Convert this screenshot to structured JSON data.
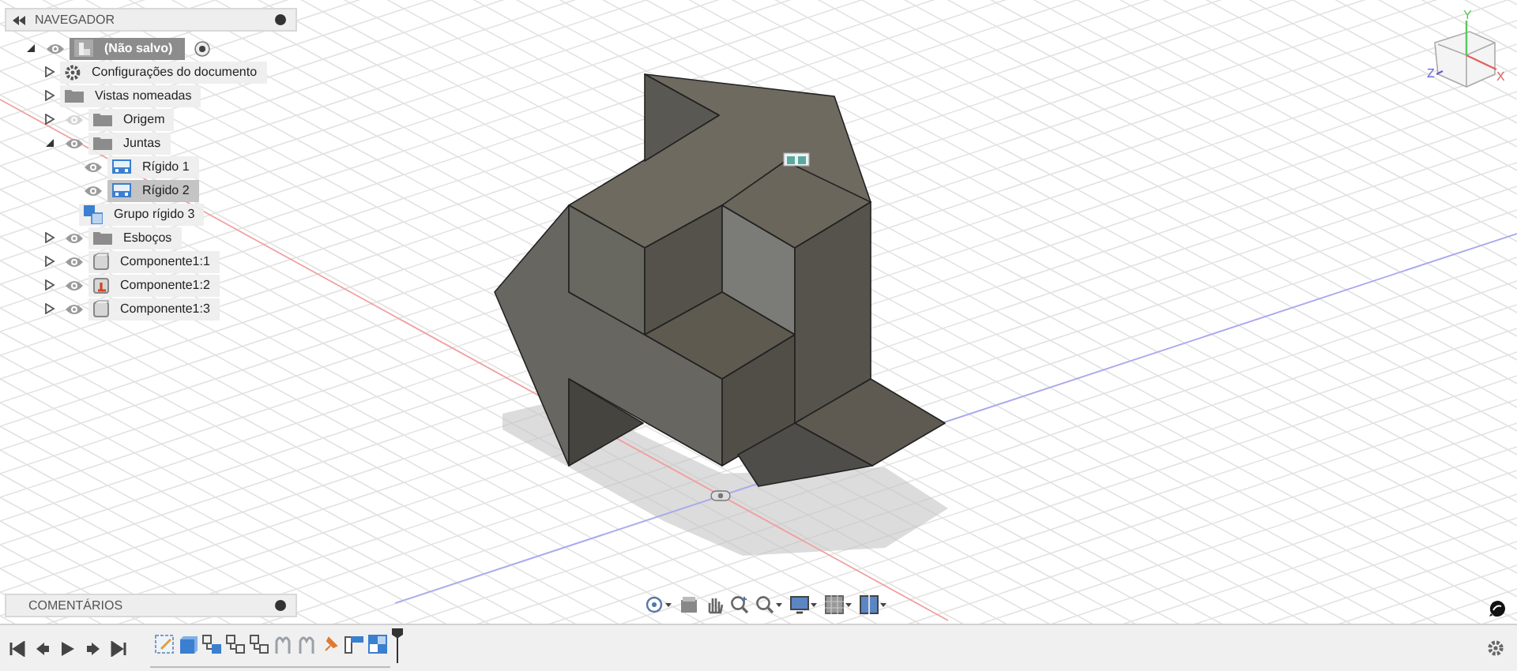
{
  "navigator": {
    "title": "NAVEGADOR",
    "tree": [
      {
        "label": "(Não salvo)",
        "kind": "document",
        "visible": true,
        "expanded": true,
        "selected": false,
        "children": [
          {
            "label": "Configurações do documento",
            "kind": "settings",
            "expanded": false,
            "selected": false
          },
          {
            "label": "Vistas nomeadas",
            "kind": "folder",
            "expanded": false,
            "selected": false
          },
          {
            "label": "Origem",
            "kind": "folder",
            "visible": false,
            "expanded": false,
            "selected": false
          },
          {
            "label": "Juntas",
            "kind": "folder",
            "visible": true,
            "expanded": true,
            "selected": false,
            "children": [
              {
                "label": "Rígido 1",
                "kind": "joint",
                "visible": true,
                "selected": false
              },
              {
                "label": "Rígido 2",
                "kind": "joint",
                "visible": true,
                "selected": true
              },
              {
                "label": "Grupo rígido 3",
                "kind": "rigid-group",
                "selected": false
              }
            ]
          },
          {
            "label": "Esboços",
            "kind": "folder",
            "visible": true,
            "expanded": false,
            "selected": false
          },
          {
            "label": "Componente1:1",
            "kind": "component",
            "visible": true,
            "expanded": false,
            "selected": false
          },
          {
            "label": "Componente1:2",
            "kind": "grounded-component",
            "visible": true,
            "expanded": false,
            "selected": false
          },
          {
            "label": "Componente1:3",
            "kind": "component",
            "visible": true,
            "expanded": false,
            "selected": false
          }
        ]
      }
    ]
  },
  "view_cube": {
    "axes": [
      "Y",
      "Z",
      "X"
    ]
  },
  "comments": {
    "title": "COMENTÁRIOS"
  },
  "timeline": {
    "features": [
      {
        "kind": "sketch"
      },
      {
        "kind": "body"
      },
      {
        "kind": "joint"
      },
      {
        "kind": "joint-alt"
      },
      {
        "kind": "joint-alt"
      },
      {
        "kind": "motion"
      },
      {
        "kind": "motion"
      },
      {
        "kind": "ground"
      },
      {
        "kind": "rigid"
      },
      {
        "kind": "rigid-group"
      }
    ]
  }
}
